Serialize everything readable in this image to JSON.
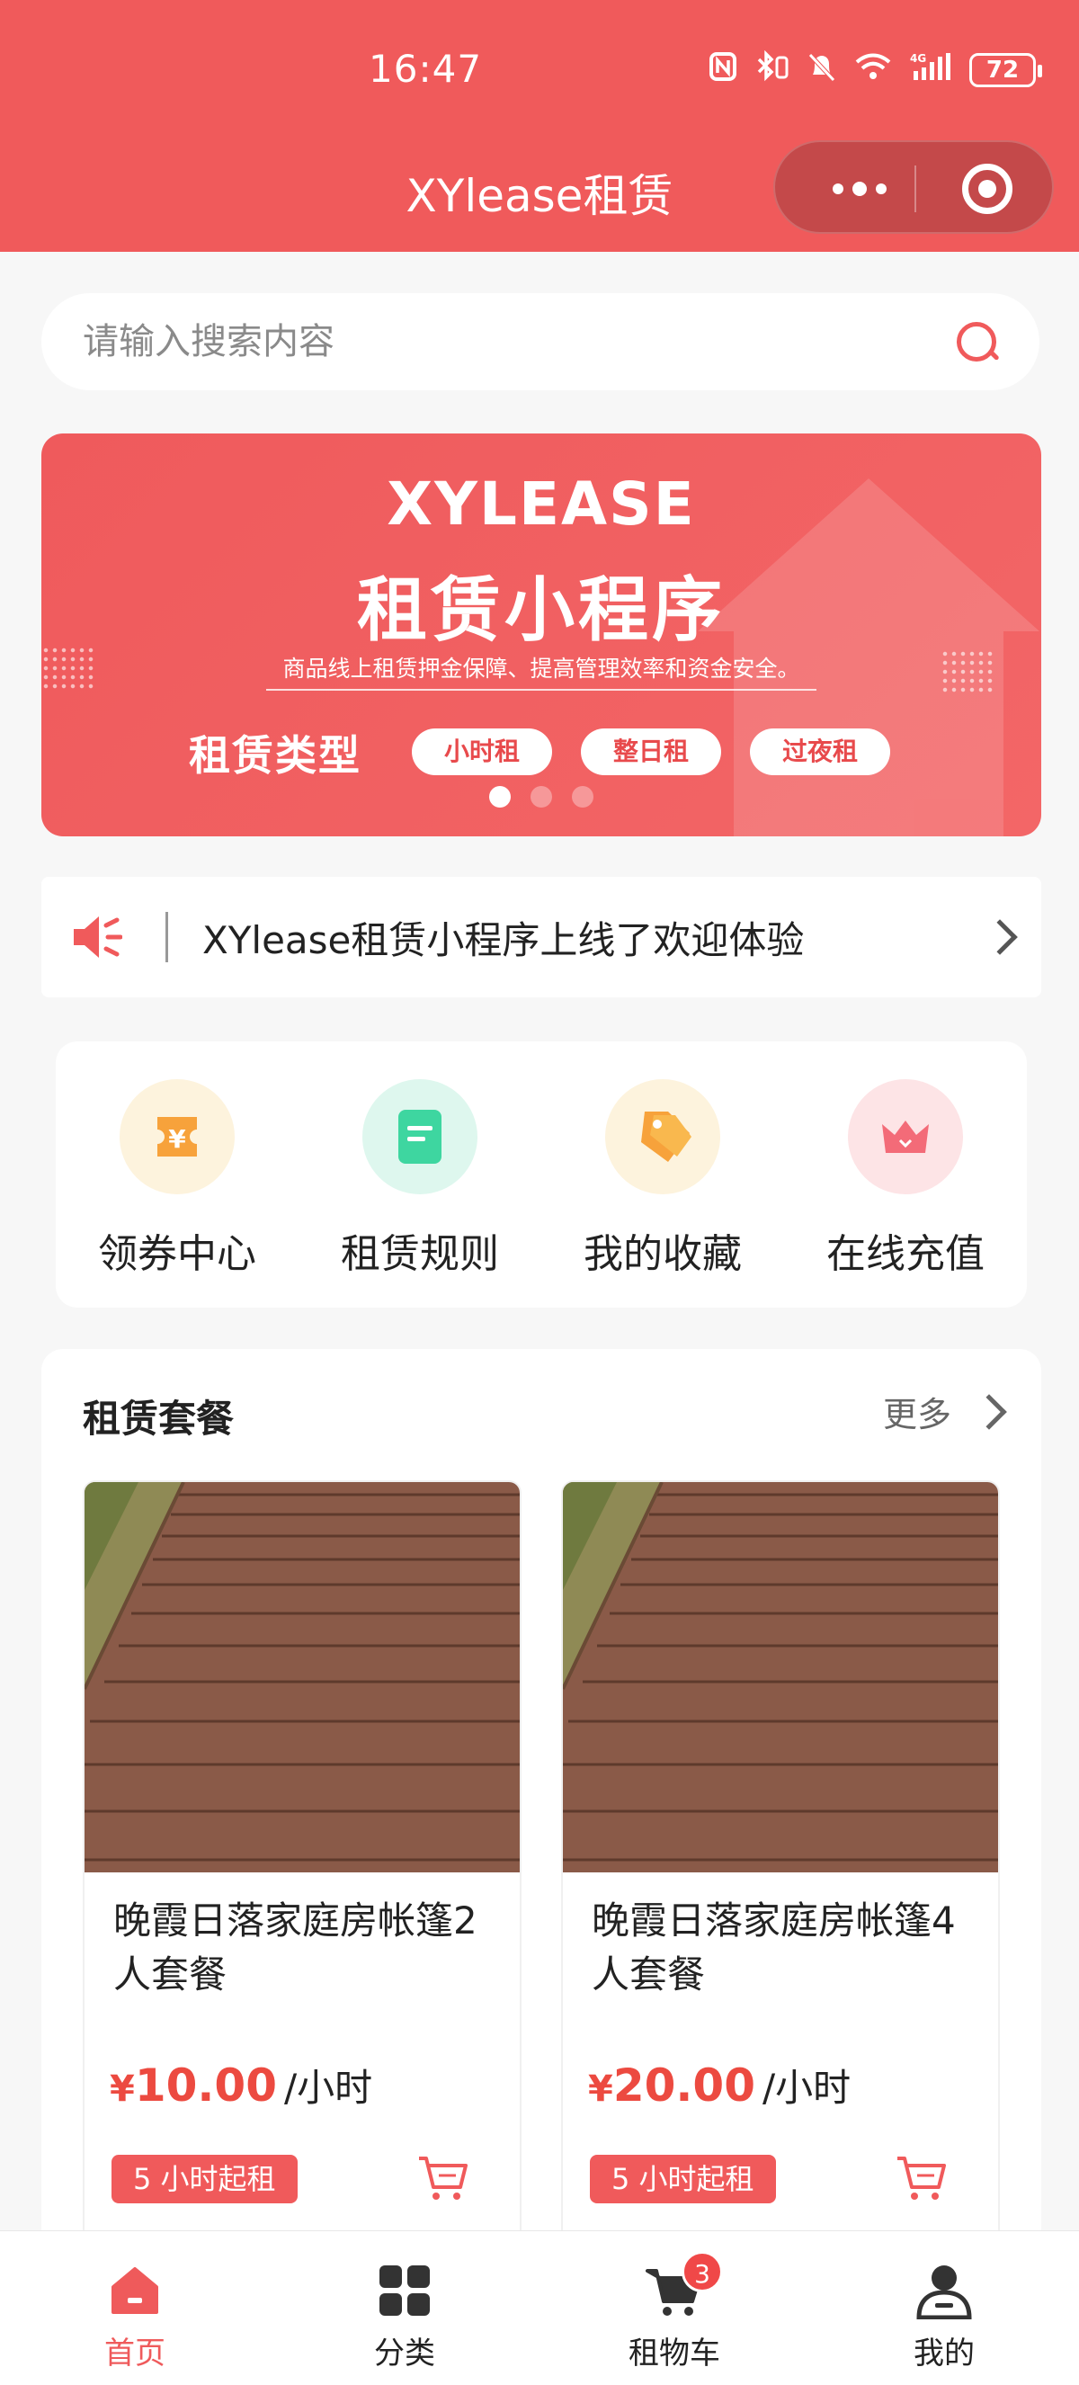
{
  "status_bar": {
    "time": "16:47",
    "battery": "72"
  },
  "nav": {
    "title": "XYlease租赁"
  },
  "search": {
    "placeholder": "请输入搜索内容"
  },
  "banner": {
    "title_en": "XYLEASE",
    "title_cn": "租赁小程序",
    "subtitle": "商品线上租赁押金保障、提高管理效率和资金安全。",
    "types_label": "租赁类型",
    "types": [
      "小时租",
      "整日租",
      "过夜租"
    ],
    "slides": 3,
    "active_slide": 1
  },
  "notice": {
    "text": "XYlease租赁小程序上线了欢迎体验"
  },
  "quick_menu": [
    {
      "label": "领券中心",
      "icon": "coupon-icon",
      "color": "#f7a23b",
      "bg": "#fdf3dd"
    },
    {
      "label": "租赁规则",
      "icon": "rules-icon",
      "color": "#3ed6a0",
      "bg": "#def7ee"
    },
    {
      "label": "我的收藏",
      "icon": "favorite-tag-icon",
      "color": "#f7a23b",
      "bg": "#fdf3dd"
    },
    {
      "label": "在线充值",
      "icon": "recharge-icon",
      "color": "#f36b78",
      "bg": "#fde4e6"
    }
  ],
  "packages": {
    "title": "租赁套餐",
    "more_label": "更多",
    "items": [
      {
        "name": "晚霞日落家庭房帐篷2人套餐",
        "yen": "¥",
        "price": "10.00",
        "unit": "/小时",
        "tag": "5 小时起租"
      },
      {
        "name": "晚霞日落家庭房帐篷4人套餐",
        "yen": "¥",
        "price": "20.00",
        "unit": "/小时",
        "tag": "5 小时起租"
      }
    ]
  },
  "tabbar": {
    "items": [
      {
        "label": "首页",
        "icon": "home-icon",
        "active": true
      },
      {
        "label": "分类",
        "icon": "category-icon",
        "active": false
      },
      {
        "label": "租物车",
        "icon": "cart-icon",
        "active": false,
        "badge": "3"
      },
      {
        "label": "我的",
        "icon": "profile-icon",
        "active": false
      }
    ]
  },
  "colors": {
    "brand": "#f05a5b",
    "price": "#ec4a40"
  }
}
